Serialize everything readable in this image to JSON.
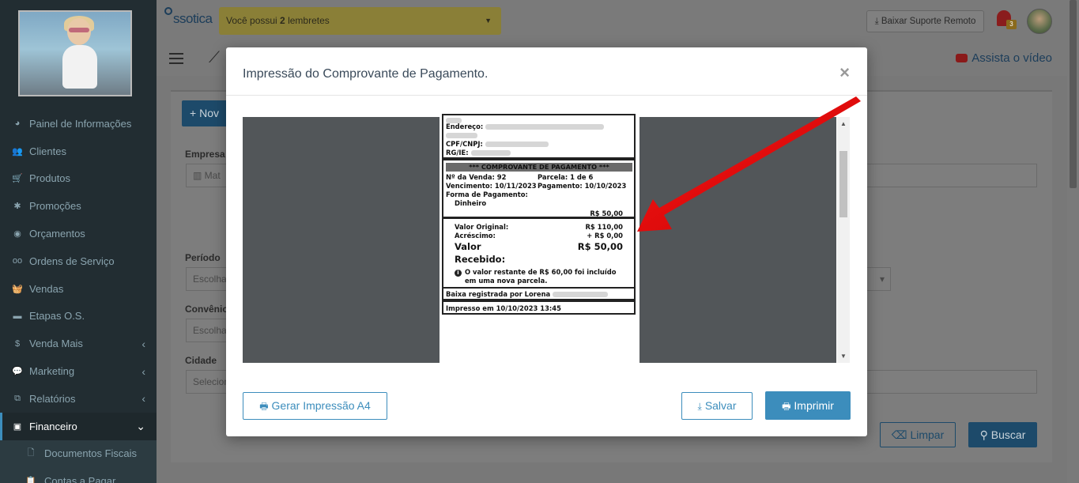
{
  "sidebar": {
    "items": [
      {
        "label": "Painel de Informações",
        "icon": "dashboard-icon",
        "chevron": ""
      },
      {
        "label": "Clientes",
        "icon": "users-icon",
        "chevron": ""
      },
      {
        "label": "Produtos",
        "icon": "cart-icon",
        "chevron": ""
      },
      {
        "label": "Promoções",
        "icon": "asterisk-icon",
        "chevron": ""
      },
      {
        "label": "Orçamentos",
        "icon": "budget-icon",
        "chevron": ""
      },
      {
        "label": "Ordens de Serviço",
        "icon": "glasses-icon",
        "chevron": ""
      },
      {
        "label": "Vendas",
        "icon": "basket-icon",
        "chevron": ""
      },
      {
        "label": "Etapas O.S.",
        "icon": "card-icon",
        "chevron": ""
      },
      {
        "label": "Venda Mais",
        "icon": "dollar-icon",
        "chevron": "‹"
      },
      {
        "label": "Marketing",
        "icon": "comments-icon",
        "chevron": "‹"
      },
      {
        "label": "Relatórios",
        "icon": "copy-icon",
        "chevron": "‹"
      },
      {
        "label": "Financeiro",
        "icon": "money-icon",
        "chevron": "⌄"
      },
      {
        "label": "Documentos Fiscais",
        "icon": "file-icon",
        "chevron": ""
      },
      {
        "label": "Contas a Pagar",
        "icon": "clipboard-icon",
        "chevron": ""
      }
    ]
  },
  "header": {
    "logo_text": "ssotica",
    "reminder_prefix": "Você possui ",
    "reminder_count": "2",
    "reminder_suffix": " lembretes",
    "remote_button": "Baixar Suporte Remoto",
    "notification_count": "3"
  },
  "subbar": {
    "watch_video": "Assista o vídeo"
  },
  "main": {
    "new_button": "Nov",
    "labels": {
      "empresa": "Empresa",
      "periodo": "Período",
      "convenio": "Convênio",
      "cidade": "Cidade"
    },
    "fields": {
      "empresa_value": "Mat",
      "periodo_value": "Escolha",
      "convenio_value": "Escolha",
      "cidade_value": "Selecion"
    },
    "clear_button": "Limpar",
    "search_button": "Buscar"
  },
  "modal": {
    "title": "Impressão do Comprovante de Pagamento.",
    "close": "×",
    "receipt": {
      "address_label": "Endereço:",
      "cpf_label": "CPF/CNPJ:",
      "rg_label": "RG/IE:",
      "section_header": "*** COMPROVANTE DE PAGAMENTO ***",
      "sale_number": "Nº da Venda: 92",
      "installment": "Parcela: 1 de 6",
      "due_date": "Vencimento: 10/11/2023",
      "payment_date": "Pagamento: 10/10/2023",
      "payment_method_label": "Forma de Pagamento:",
      "payment_method": "Dinheiro",
      "installment_value": "R$ 50,00",
      "original_value_label": "Valor Original:",
      "original_value": "R$ 110,00",
      "addition_label": "Acréscimo:",
      "addition_value": "+ R$ 0,00",
      "received_label_1": "Valor",
      "received_label_2": "Recebido:",
      "received_value": "R$ 50,00",
      "note_line_1": "O valor restante de R$ 60,00 foi incluído",
      "note_line_2": "em uma nova parcela.",
      "registered_by": "Baixa registrada por Lorena",
      "printed_at": "Impresso em 10/10/2023 13:45"
    },
    "buttons": {
      "a4": "Gerar Impressão A4",
      "save": "Salvar",
      "print": "Imprimir"
    }
  },
  "colors": {
    "primary": "#3c8dbc",
    "sidebar_bg": "#222d32",
    "arrow": "#e00000"
  }
}
